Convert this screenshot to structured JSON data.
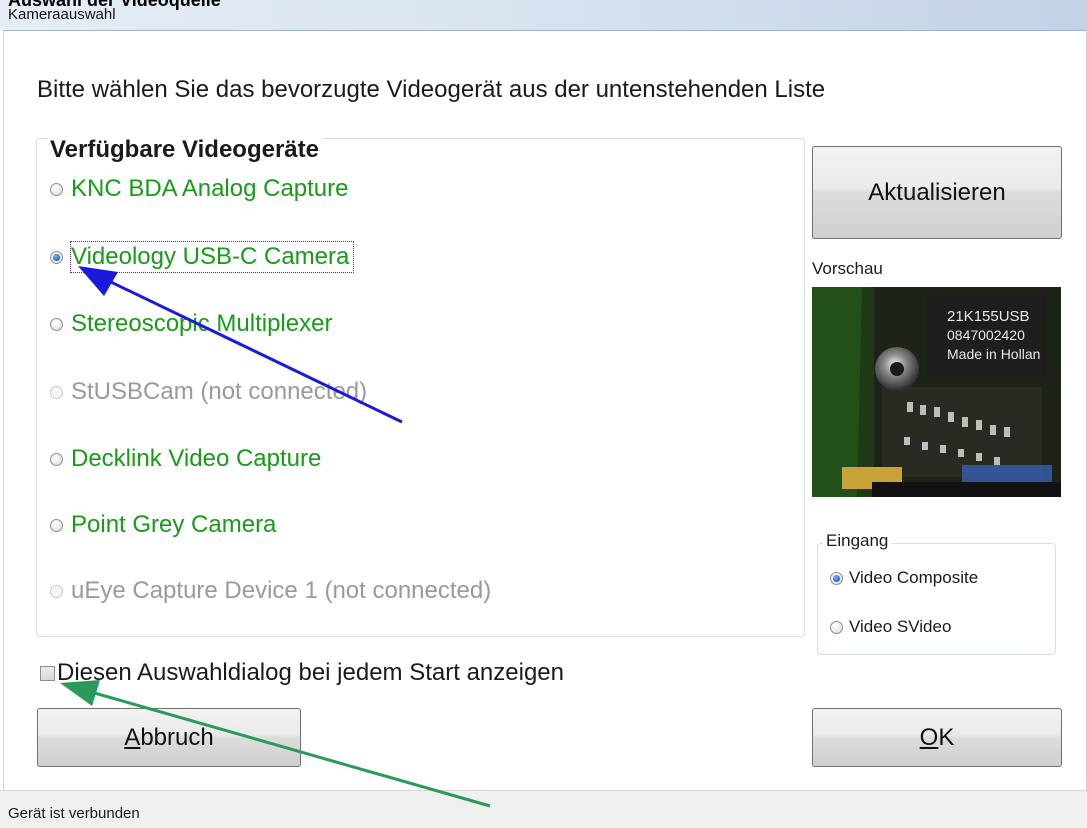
{
  "window": {
    "title": "Kameraauswahl",
    "ghost_title": "Auswahl der Videoquelle",
    "bg_color": "#ffffff"
  },
  "instruction": "Bitte wählen Sie das bevorzugte Videogerät aus der untenstehenden Liste",
  "devices": {
    "group_title": "Verfügbare Videogeräte",
    "items": [
      {
        "label": "KNC BDA Analog Capture",
        "checked": false,
        "enabled": true
      },
      {
        "label": "Videology USB-C Camera",
        "checked": true,
        "enabled": true,
        "focused": true
      },
      {
        "label": "Stereoscopic Multiplexer",
        "checked": false,
        "enabled": true
      },
      {
        "label": "StUSBCam (not connected)",
        "checked": false,
        "enabled": false
      },
      {
        "label": "Decklink Video Capture",
        "checked": false,
        "enabled": true
      },
      {
        "label": "Point Grey Camera",
        "checked": false,
        "enabled": true
      },
      {
        "label": "uEye Capture Device 1 (not connected)",
        "checked": false,
        "enabled": false
      }
    ],
    "enabled_color": "#1a9a1a",
    "disabled_color": "#9a9a9a"
  },
  "refresh_button": "Aktualisieren",
  "preview": {
    "label": "Vorschau",
    "chip_text": [
      "21K155USB",
      "0847002420",
      "Made in Hollan"
    ]
  },
  "input": {
    "group_title": "Eingang",
    "options": [
      {
        "label": "Video Composite",
        "checked": true
      },
      {
        "label": "Video SVideo",
        "checked": false
      }
    ]
  },
  "show_dialog_checkbox": {
    "label": "Diesen Auswahldialog bei jedem Start anzeigen",
    "checked": false
  },
  "buttons": {
    "cancel": {
      "label": "Abbruch",
      "mnemonic": "A"
    },
    "ok": {
      "label": "OK",
      "mnemonic": "O"
    }
  },
  "status": "Gerät ist verbunden",
  "annotations": {
    "blue_arrow_color": "#1a1adc",
    "green_arrow_color": "#2a9a5a"
  }
}
